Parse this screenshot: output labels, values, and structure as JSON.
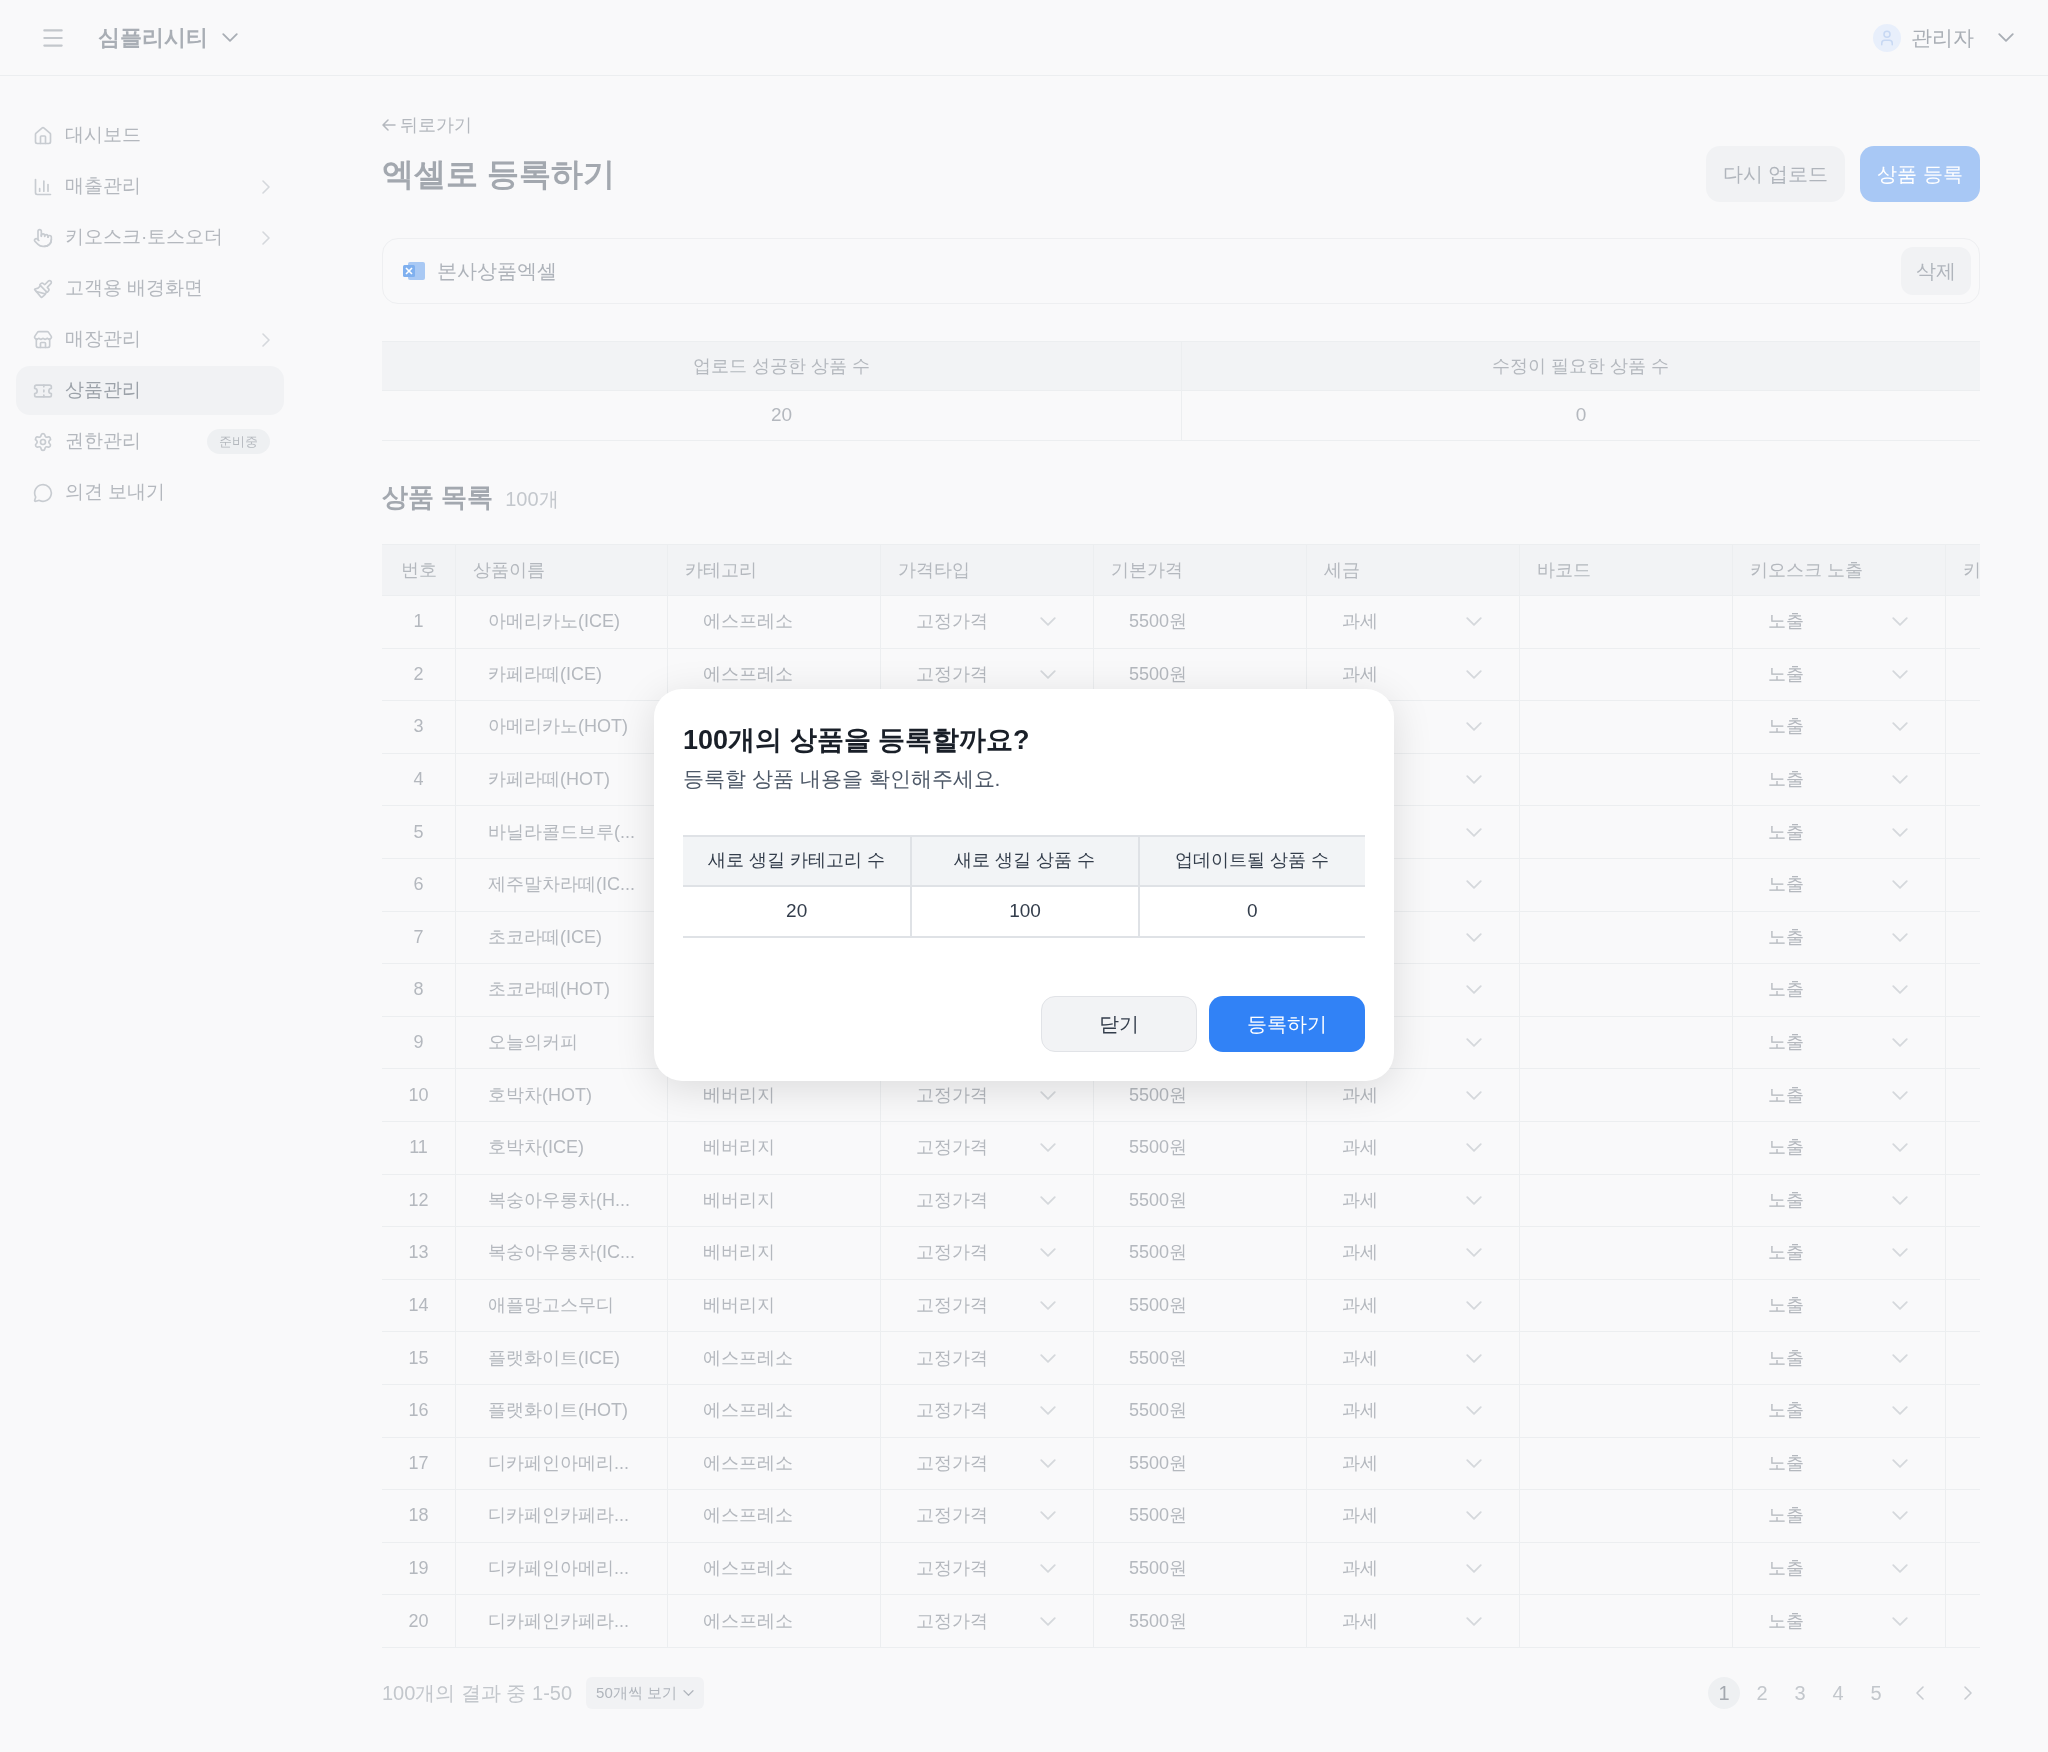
{
  "header": {
    "brand": "심플리시티",
    "user": "관리자"
  },
  "sidebar": {
    "items": [
      {
        "label": "대시보드",
        "submenu": false,
        "selected": false
      },
      {
        "label": "매출관리",
        "submenu": true,
        "selected": false
      },
      {
        "label": "키오스크·토스오더",
        "submenu": true,
        "selected": false
      },
      {
        "label": "고객용 배경화면",
        "submenu": false,
        "selected": false
      },
      {
        "label": "매장관리",
        "submenu": true,
        "selected": false
      },
      {
        "label": "상품관리",
        "submenu": false,
        "selected": true
      },
      {
        "label": "권한관리",
        "submenu": false,
        "selected": false,
        "badge": "준비중"
      },
      {
        "label": "의견 보내기",
        "submenu": false,
        "selected": false
      }
    ]
  },
  "page": {
    "back": "뒤로가기",
    "title": "엑셀로 등록하기",
    "buttons": [
      {
        "label": "다시 업로드",
        "kind": "secondary"
      },
      {
        "label": "상품 등록",
        "kind": "primary"
      }
    ]
  },
  "file": {
    "name": "본사상품엑셀",
    "delete": "삭제"
  },
  "summary": {
    "columns": [
      "업로드 성공한 상품 수",
      "수정이 필요한 상품 수"
    ],
    "values": [
      "20",
      "0"
    ]
  },
  "list": {
    "title": "상품 목록",
    "count": "100개",
    "columns": [
      "번호",
      "상품이름",
      "카테고리",
      "가격타입",
      "기본가격",
      "세금",
      "바코드",
      "키오스크 노출",
      "키"
    ],
    "rows": [
      {
        "no": "1",
        "name": "아메리카노(ICE)",
        "category": "에스프레소",
        "price_type": "고정가격",
        "price": "5500원",
        "tax": "과세",
        "kiosk": "노출"
      },
      {
        "no": "2",
        "name": "카페라떼(ICE)",
        "category": "에스프레소",
        "price_type": "고정가격",
        "price": "5500원",
        "tax": "과세",
        "kiosk": "노출"
      },
      {
        "no": "3",
        "name": "아메리카노(HOT)",
        "kiosk": "노출"
      },
      {
        "no": "4",
        "name": "카페라떼(HOT)",
        "kiosk": "노출"
      },
      {
        "no": "5",
        "name": "바닐라콜드브루(...",
        "kiosk": "노출"
      },
      {
        "no": "6",
        "name": "제주말차라떼(IC...",
        "kiosk": "노출"
      },
      {
        "no": "7",
        "name": "초코라떼(ICE)",
        "kiosk": "노출"
      },
      {
        "no": "8",
        "name": "초코라떼(HOT)",
        "kiosk": "노출"
      },
      {
        "no": "9",
        "name": "오늘의커피",
        "kiosk": "노출"
      },
      {
        "no": "10",
        "name": "호박차(HOT)",
        "category": "베버리지",
        "price_type": "고정가격",
        "price": "5500원",
        "tax": "과세",
        "kiosk": "노출"
      },
      {
        "no": "11",
        "name": "호박차(ICE)",
        "category": "베버리지",
        "price_type": "고정가격",
        "price": "5500원",
        "tax": "과세",
        "kiosk": "노출"
      },
      {
        "no": "12",
        "name": "복숭아우롱차(H...",
        "category": "베버리지",
        "price_type": "고정가격",
        "price": "5500원",
        "tax": "과세",
        "kiosk": "노출"
      },
      {
        "no": "13",
        "name": "복숭아우롱차(IC...",
        "category": "베버리지",
        "price_type": "고정가격",
        "price": "5500원",
        "tax": "과세",
        "kiosk": "노출"
      },
      {
        "no": "14",
        "name": "애플망고스무디",
        "category": "베버리지",
        "price_type": "고정가격",
        "price": "5500원",
        "tax": "과세",
        "kiosk": "노출"
      },
      {
        "no": "15",
        "name": "플랫화이트(ICE)",
        "category": "에스프레소",
        "price_type": "고정가격",
        "price": "5500원",
        "tax": "과세",
        "kiosk": "노출"
      },
      {
        "no": "16",
        "name": "플랫화이트(HOT)",
        "category": "에스프레소",
        "price_type": "고정가격",
        "price": "5500원",
        "tax": "과세",
        "kiosk": "노출"
      },
      {
        "no": "17",
        "name": "디카페인아메리...",
        "category": "에스프레소",
        "price_type": "고정가격",
        "price": "5500원",
        "tax": "과세",
        "kiosk": "노출"
      },
      {
        "no": "18",
        "name": "디카페인카페라...",
        "category": "에스프레소",
        "price_type": "고정가격",
        "price": "5500원",
        "tax": "과세",
        "kiosk": "노출"
      },
      {
        "no": "19",
        "name": "디카페인아메리...",
        "category": "에스프레소",
        "price_type": "고정가격",
        "price": "5500원",
        "tax": "과세",
        "kiosk": "노출"
      },
      {
        "no": "20",
        "name": "디카페인카페라...",
        "category": "에스프레소",
        "price_type": "고정가격",
        "price": "5500원",
        "tax": "과세",
        "kiosk": "노출"
      }
    ]
  },
  "pagination": {
    "summary": "100개의 결과 중 1-50",
    "page_size": "50개씩 보기",
    "pages": [
      {
        "label": "1",
        "selected": true
      },
      {
        "label": "2",
        "selected": false
      },
      {
        "label": "3",
        "selected": false
      },
      {
        "label": "4",
        "selected": false
      },
      {
        "label": "5",
        "selected": false
      }
    ]
  },
  "modal": {
    "title": "100개의 상품을 등록할까요?",
    "subtitle": "등록할 상품 내용을 확인해주세요.",
    "columns": [
      "새로 생길 카테고리 수",
      "새로 생길 상품 수",
      "업데이트될 상품 수"
    ],
    "values": [
      "20",
      "100",
      "0"
    ],
    "buttons": [
      {
        "label": "닫기",
        "kind": "secondary"
      },
      {
        "label": "등록하기",
        "kind": "primary"
      }
    ]
  }
}
